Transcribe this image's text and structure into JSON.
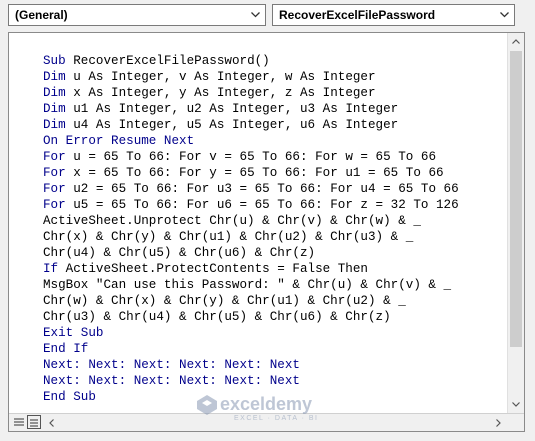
{
  "object_combo": {
    "value": "(General)"
  },
  "procedure_combo": {
    "value": "RecoverExcelFilePassword"
  },
  "code": {
    "lines": [
      {
        "kw": "Sub",
        "text": " RecoverExcelFilePassword()"
      },
      {
        "kw": "Dim",
        "text": " u As Integer, v As Integer, w As Integer"
      },
      {
        "kw": "Dim",
        "text": " x As Integer, y As Integer, z As Integer"
      },
      {
        "kw": "Dim",
        "text": " u1 As Integer, u2 As Integer, u3 As Integer"
      },
      {
        "kw": "Dim",
        "text": " u4 As Integer, u5 As Integer, u6 As Integer"
      },
      {
        "kw": "On Error Resume Next",
        "text": ""
      },
      {
        "kw": "For",
        "text": " u = 65 To 66: For v = 65 To 66: For w = 65 To 66"
      },
      {
        "kw": "For",
        "text": " x = 65 To 66: For y = 65 To 66: For u1 = 65 To 66"
      },
      {
        "kw": "For",
        "text": " u2 = 65 To 66: For u3 = 65 To 66: For u4 = 65 To 66"
      },
      {
        "kw": "For",
        "text": " u5 = 65 To 66: For u6 = 65 To 66: For z = 32 To 126"
      },
      {
        "kw": "",
        "text": "ActiveSheet.Unprotect Chr(u) & Chr(v) & Chr(w) & _"
      },
      {
        "kw": "",
        "text": "Chr(x) & Chr(y) & Chr(u1) & Chr(u2) & Chr(u3) & _"
      },
      {
        "kw": "",
        "text": "Chr(u4) & Chr(u5) & Chr(u6) & Chr(z)"
      },
      {
        "kw": "If",
        "text": " ActiveSheet.ProtectContents = False Then"
      },
      {
        "kw": "",
        "text": "MsgBox \"Can use this Password: \" & Chr(u) & Chr(v) & _"
      },
      {
        "kw": "",
        "text": "Chr(w) & Chr(x) & Chr(y) & Chr(u1) & Chr(u2) & _"
      },
      {
        "kw": "",
        "text": "Chr(u3) & Chr(u4) & Chr(u5) & Chr(u6) & Chr(z)"
      },
      {
        "kw": "Exit Sub",
        "text": ""
      },
      {
        "kw": "End If",
        "text": ""
      },
      {
        "kw": "Next: Next: Next: Next: Next: Next",
        "text": ""
      },
      {
        "kw": "Next: Next: Next: Next: Next: Next",
        "text": ""
      },
      {
        "kw": "End Sub",
        "text": ""
      }
    ]
  },
  "watermark": {
    "brand": "exceldemy",
    "tagline": "EXCEL · DATA · BI"
  },
  "icons": {
    "dropdown": "chevron-down-icon",
    "scroll_up": "arrow-up-icon",
    "scroll_down": "arrow-down-icon",
    "scroll_left": "arrow-left-icon",
    "scroll_right": "arrow-right-icon",
    "procedure_view": "procedure-view-icon",
    "full_module_view": "full-module-view-icon"
  },
  "colors": {
    "keyword": "#00008b",
    "text": "#000000",
    "background": "#ffffff"
  }
}
